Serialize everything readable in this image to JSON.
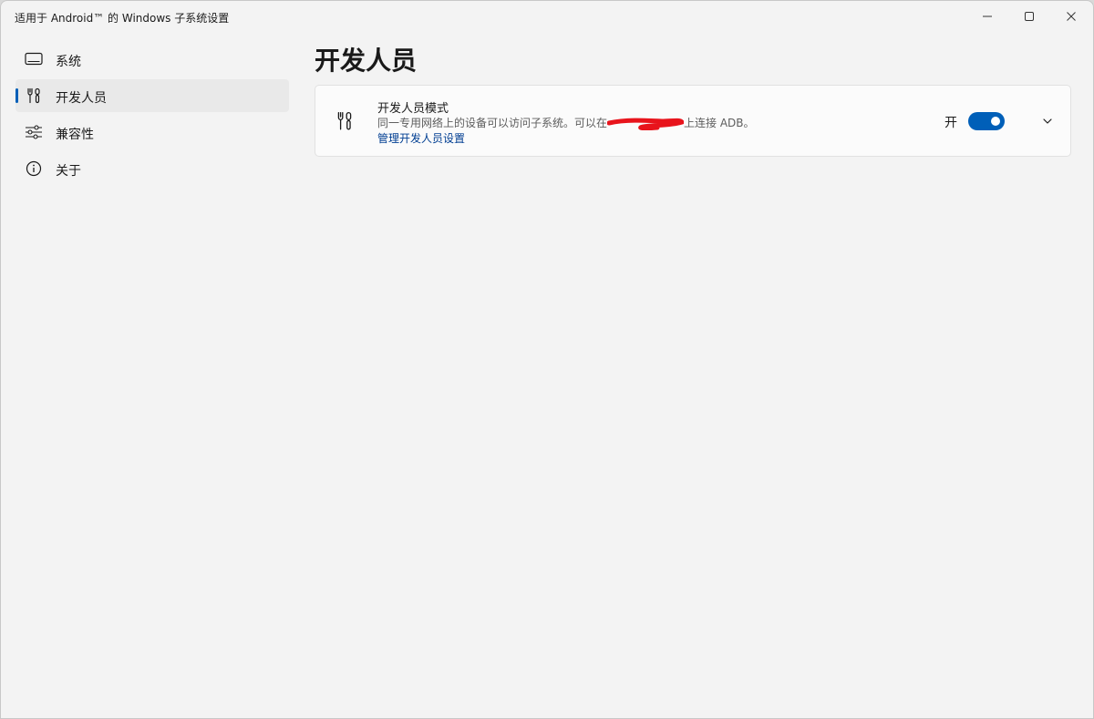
{
  "window": {
    "title": "适用于 Android™ 的 Windows 子系统设置",
    "controls": [
      "minimize-icon",
      "maximize-icon",
      "close-icon"
    ]
  },
  "sidebar": {
    "items": [
      {
        "label": "系统",
        "icon": "display-icon",
        "active": false
      },
      {
        "label": "开发人员",
        "icon": "tools-icon",
        "active": true
      },
      {
        "label": "兼容性",
        "icon": "sliders-icon",
        "active": false
      },
      {
        "label": "关于",
        "icon": "info-icon",
        "active": false
      }
    ]
  },
  "main": {
    "title": "开发人员",
    "card": {
      "icon": "tools-icon",
      "title": "开发人员模式",
      "description_before": "同一专用网络上的设备可以访问子系统。可以在",
      "description_after": "上连接 ADB。",
      "link": "管理开发人员设置",
      "toggle_label": "开",
      "toggle_on": true,
      "expand_icon": "chevron-down-icon"
    }
  },
  "colors": {
    "accent": "#005fb8",
    "link": "#003e92",
    "background": "#f3f3f3",
    "card": "#fbfbfb",
    "redaction": "#e8141c"
  }
}
